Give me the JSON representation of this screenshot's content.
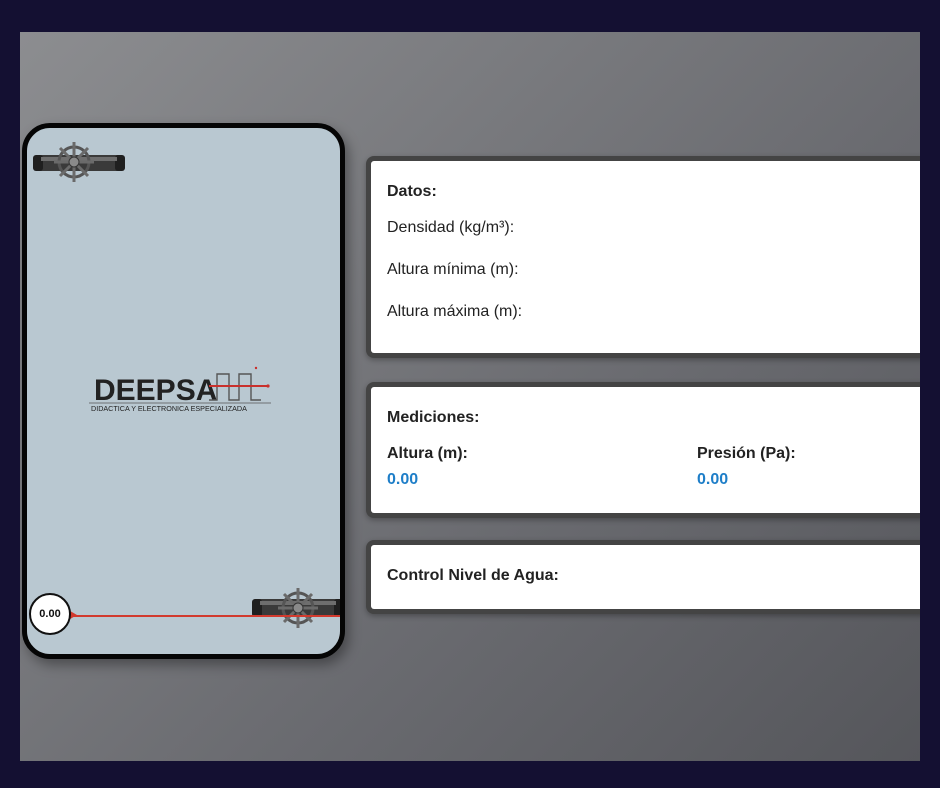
{
  "tank": {
    "level_value": "0.00",
    "fill_fraction": 0,
    "water_color": "#b9c8d1",
    "level_line_color": "#d23a2e"
  },
  "logo": {
    "brand": "DEEPSA",
    "tagline": "DIDACTICA Y ELECTRONICA ESPECIALIZADA"
  },
  "datos": {
    "title": "Datos:",
    "density_label": "Densidad (kg/m³):",
    "min_height_label": "Altura mínima (m):",
    "max_height_label": "Altura máxima (m):"
  },
  "mediciones": {
    "title": "Mediciones:",
    "height_label": "Altura (m):",
    "height_value": "0.00",
    "pressure_label": "Presión (Pa):",
    "pressure_value": "0.00",
    "value_color": "#1e7ec8"
  },
  "control": {
    "title": "Control Nivel de Agua:"
  },
  "icons": {
    "valve": "valve-wheel-icon",
    "logo": "deepsa-logo"
  }
}
